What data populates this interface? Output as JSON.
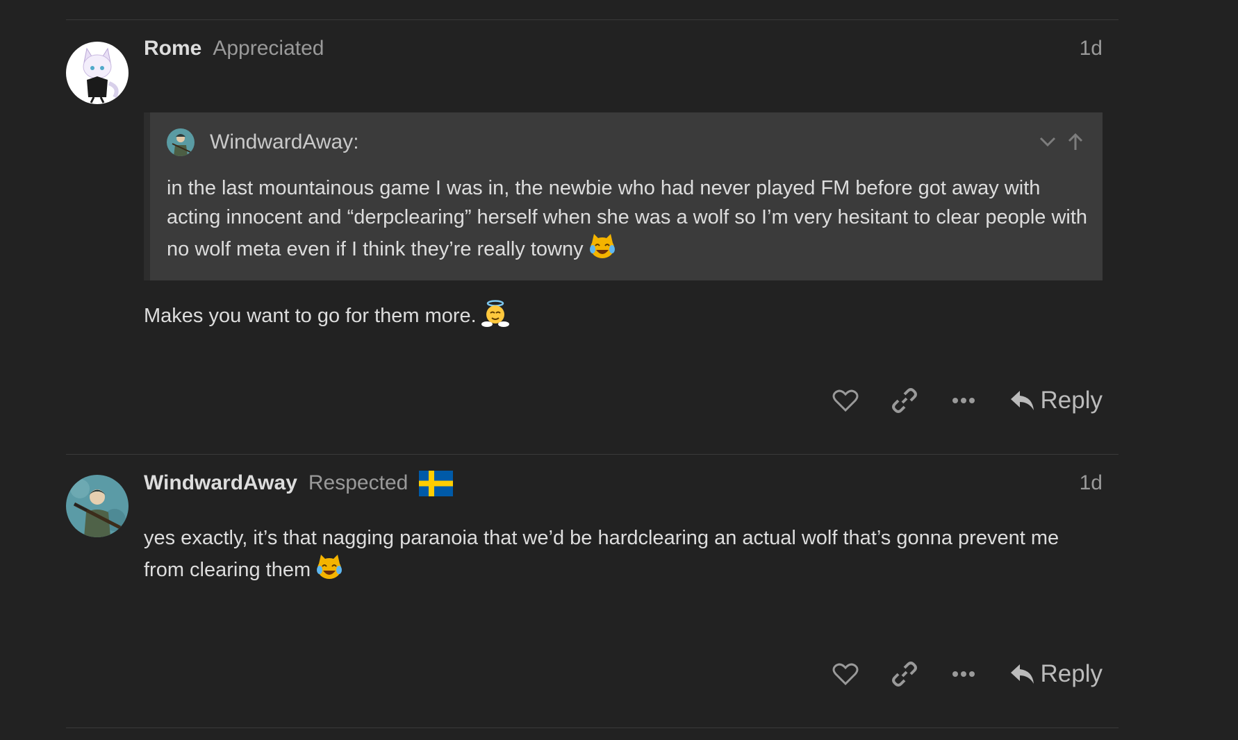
{
  "posts": [
    {
      "username": "Rome",
      "user_title": "Appreciated",
      "date": "1d",
      "avatar_icon": "anime-cat-girl-avatar-icon",
      "quote": {
        "author": "WindwardAway:",
        "text": "in the last mountainous game I was in, the newbie who had never played FM before got away with acting innocent and “derpclearing” herself when she was a wolf so I’m very hesitant to clear people with no wolf meta even if I think they’re really towny",
        "emoji": "joy-cat-emoji"
      },
      "body": "Makes you want to go for them more.",
      "body_emoji": "innocent-angel-emoji",
      "reply_label": "Reply"
    },
    {
      "username": "WindwardAway",
      "user_title": "Respected",
      "flag": "sweden-flag",
      "date": "1d",
      "avatar_icon": "soldier-with-rifle-avatar-icon",
      "body": "yes exactly, it’s that nagging paranoia that we’d be hardclearing an actual wolf that’s gonna prevent me from clearing them",
      "body_emoji": "joy-cat-emoji",
      "reply_label": "Reply"
    }
  ],
  "colors": {
    "background": "#222222",
    "quote_background": "#3b3b3b",
    "username": "#dddddd",
    "muted": "#9a9a9a",
    "sweden_blue": "#005aa8",
    "sweden_yellow": "#ffcd00"
  }
}
